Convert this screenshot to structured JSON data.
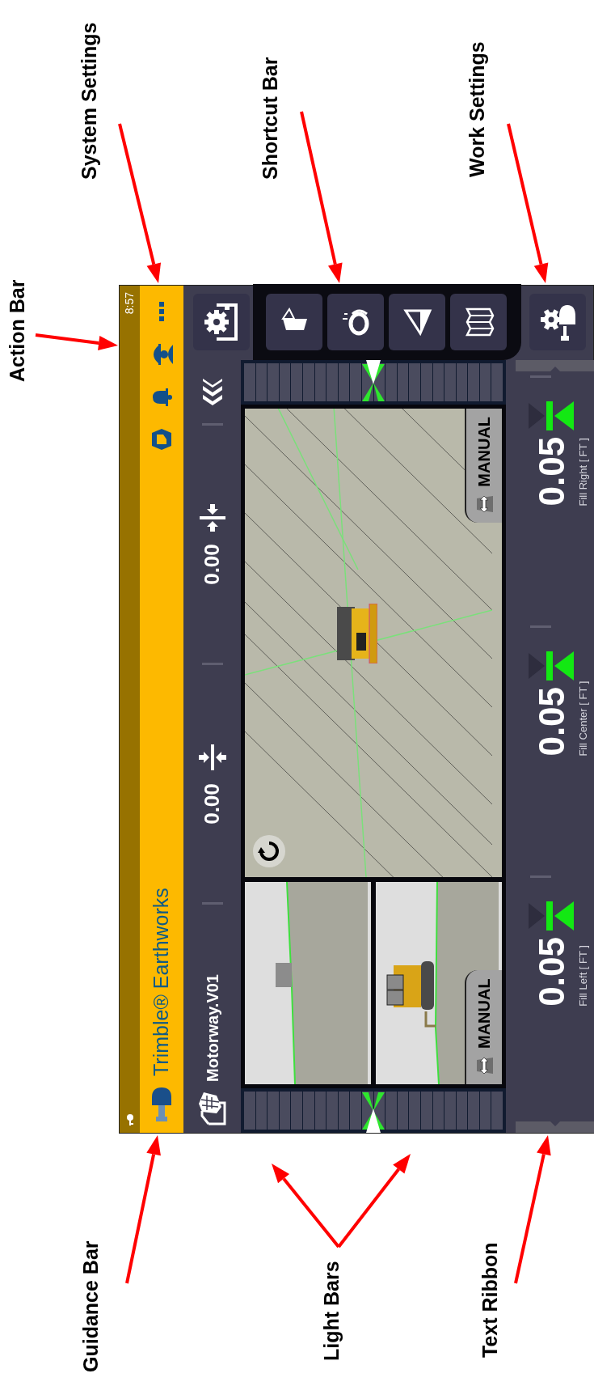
{
  "annotations": [
    {
      "label": "Action Bar"
    },
    {
      "label": "System Settings"
    },
    {
      "label": "Shortcut Bar"
    },
    {
      "label": "Work Settings"
    },
    {
      "label": "Guidance Bar"
    },
    {
      "label": "Light Bars"
    },
    {
      "label": "Text Ribbon"
    }
  ],
  "status_bar": {
    "time": "8:57"
  },
  "action_bar": {
    "title": "Trimble® Earthworks"
  },
  "guidance_bar": {
    "design_name": "Motorway.V01",
    "readouts": [
      {
        "value": "0.00",
        "kind": "vertical"
      },
      {
        "value": "0.00",
        "kind": "horizontal"
      }
    ]
  },
  "views": [
    {
      "mode": "MANUAL"
    },
    {
      "mode": "MANUAL"
    }
  ],
  "text_ribbon": {
    "items": [
      {
        "value": "0.05",
        "label": "Fill Left [ FT ]"
      },
      {
        "value": "0.05",
        "label": "Fill Center [ FT ]"
      },
      {
        "value": "0.05",
        "label": "Fill Right [ FT ]"
      }
    ]
  }
}
